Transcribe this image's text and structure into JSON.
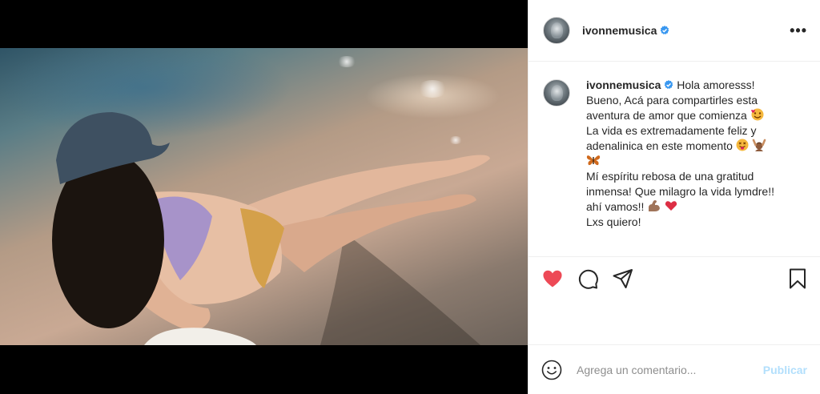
{
  "post": {
    "username": "ivonnemusica",
    "caption_lines": [
      "Hola amoresss!",
      "Bueno, Acá para compartirles esta",
      "aventura de amor que comienza",
      "La vida es extremadamente feliz y",
      "adenalinica en este momento",
      "",
      "Mí espíritu rebosa de una gratitud",
      "inmensa! Que milagro la vida lymdre!!",
      "ahí vamos!!",
      "Lxs quiero!"
    ],
    "comment_placeholder": "Agrega un comentario...",
    "publish_label": "Publicar",
    "more_label": "•••"
  },
  "colors": {
    "like_red": "#ed4956",
    "verified_blue": "#3897f0",
    "publish_disabled": "#b2dffc"
  },
  "icons": {
    "like": "heart-icon",
    "comment": "comment-icon",
    "share": "paper-plane-icon",
    "save": "bookmark-icon",
    "emoji": "smiley-icon",
    "verified": "verified-badge-icon"
  }
}
